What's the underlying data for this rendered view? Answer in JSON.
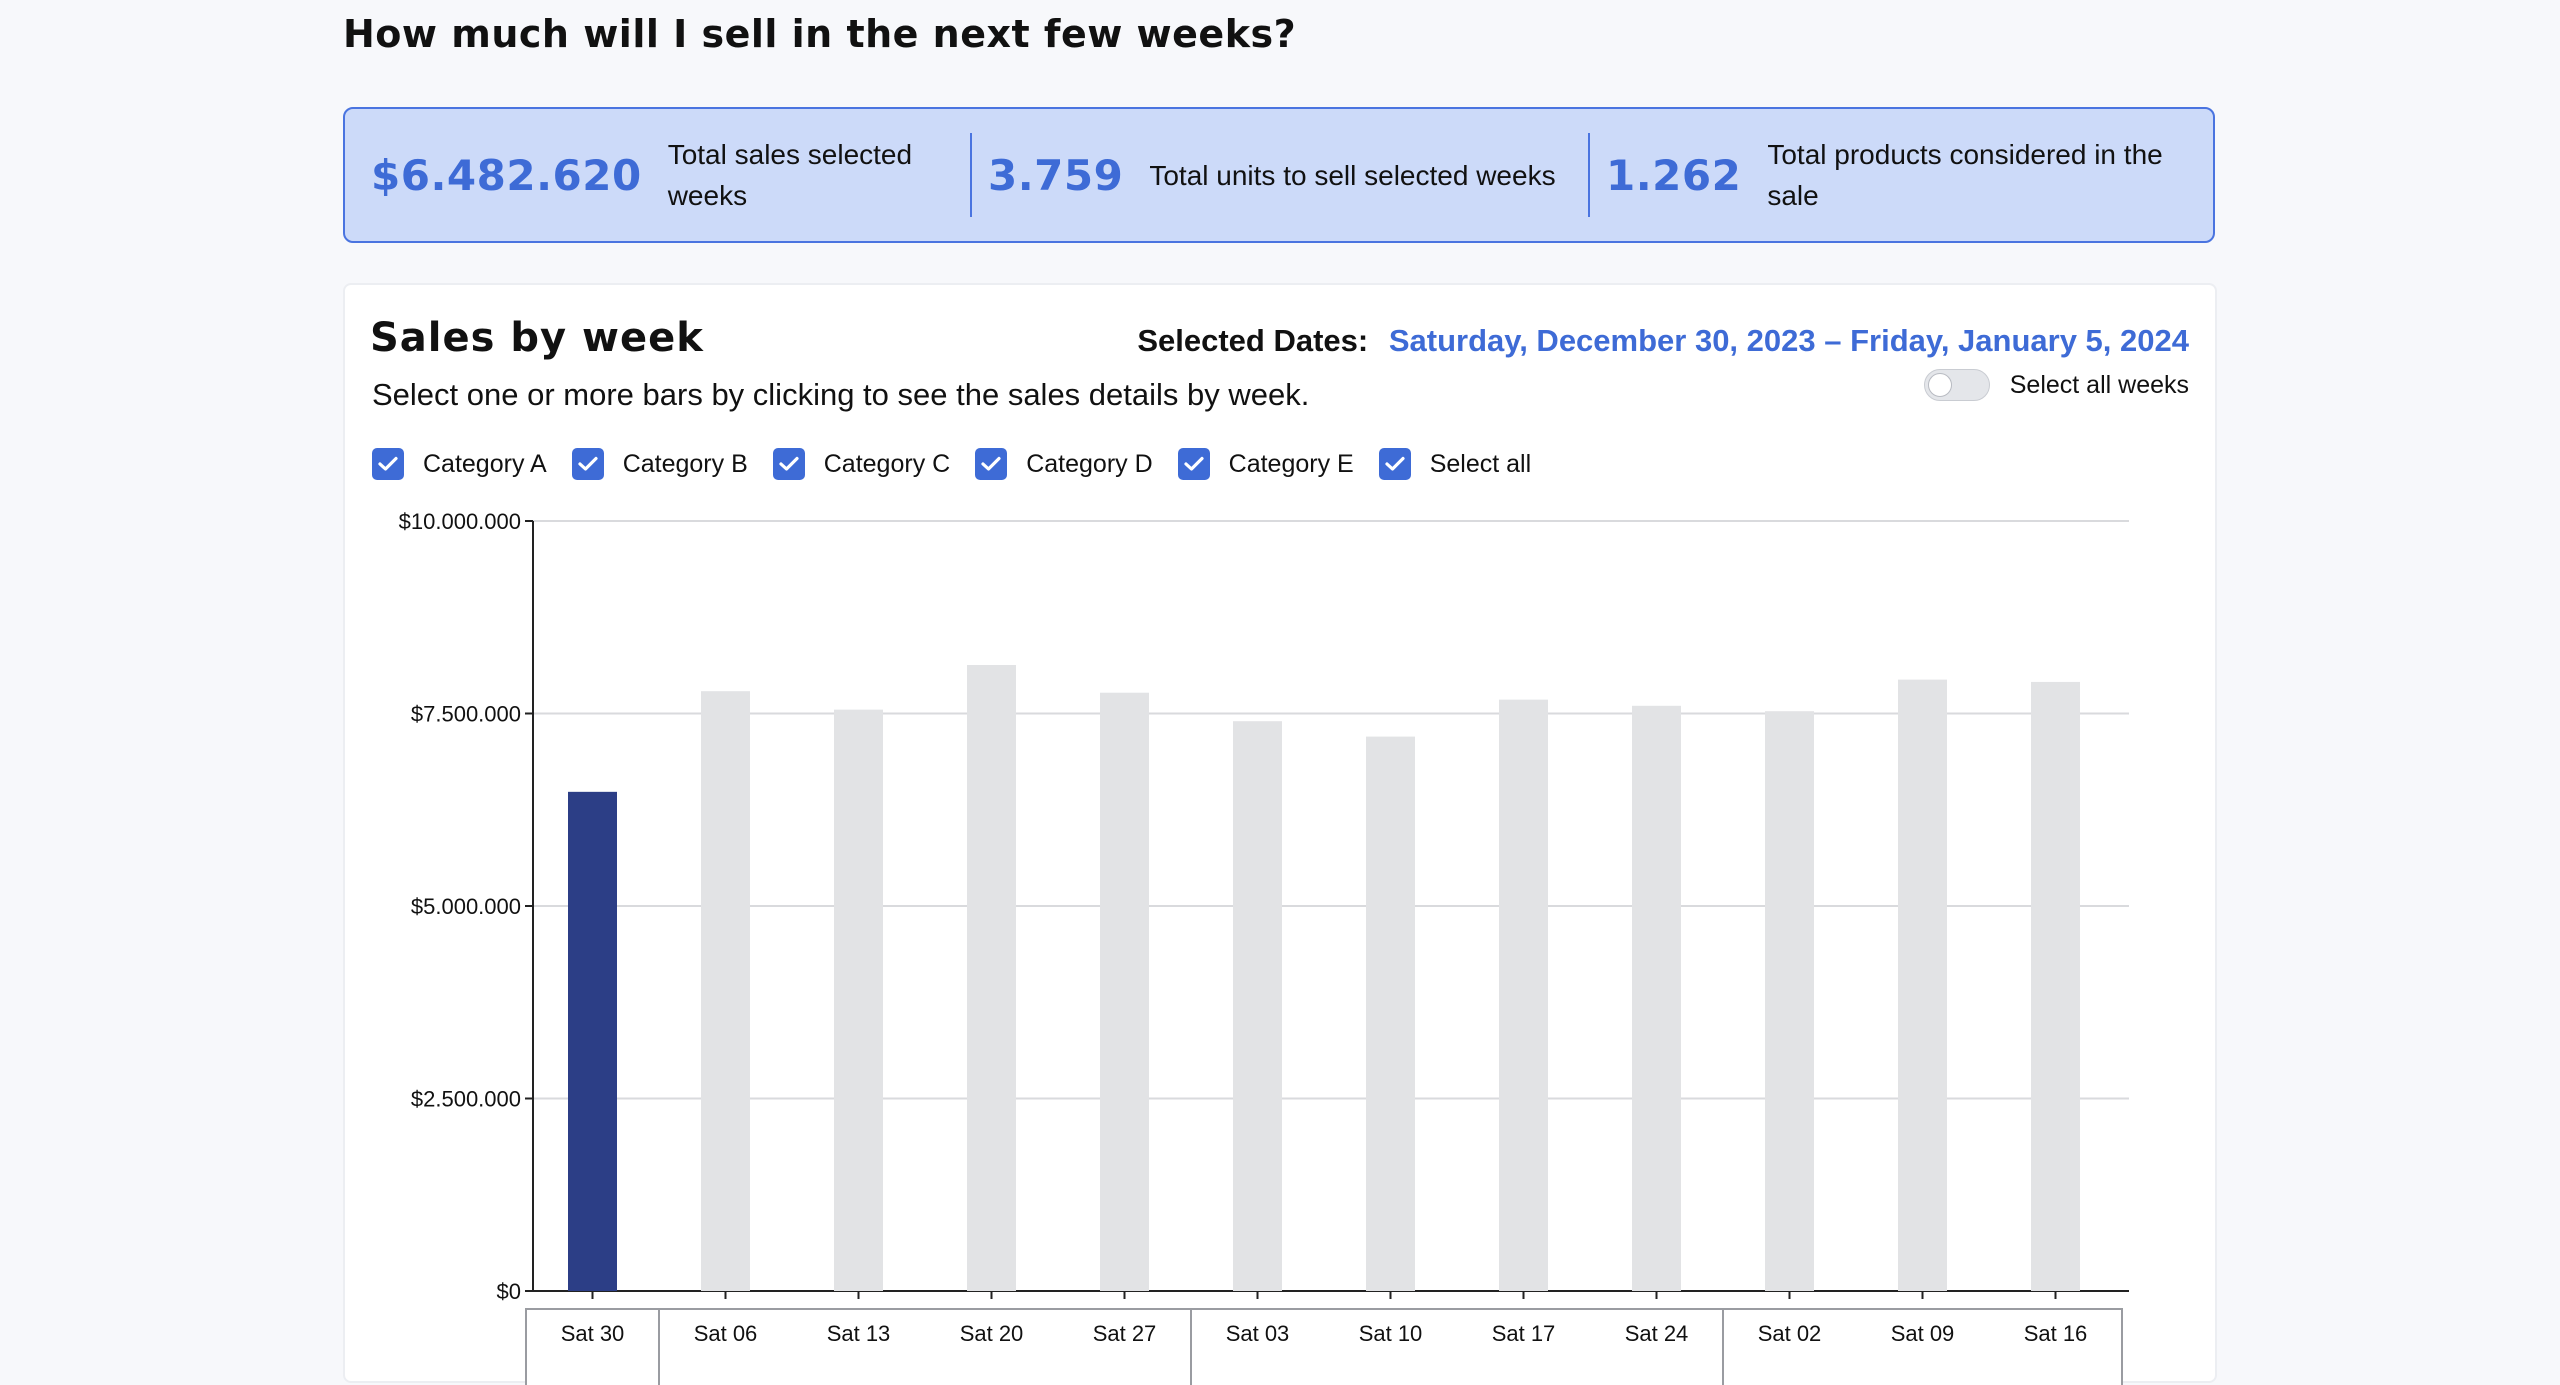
{
  "page": {
    "title": "How much will I sell in the next few weeks?"
  },
  "kpis": [
    {
      "value": "$6.482.620",
      "label": "Total sales selected weeks"
    },
    {
      "value": "3.759",
      "label": "Total units to sell selected weeks"
    },
    {
      "value": "1.262",
      "label": "Total products considered in the sale"
    }
  ],
  "card": {
    "title": "Sales by week",
    "subtitle": "Select one or more bars by clicking to see the sales details by week.",
    "dates_label": "Selected Dates:",
    "dates_value": "Saturday, December 30, 2023 – Friday, January 5, 2024",
    "toggle_label": "Select all weeks",
    "toggle_on": false
  },
  "filters": [
    {
      "label": "Category A",
      "checked": true
    },
    {
      "label": "Category B",
      "checked": true
    },
    {
      "label": "Category C",
      "checked": true
    },
    {
      "label": "Category D",
      "checked": true
    },
    {
      "label": "Category E",
      "checked": true
    },
    {
      "label": "Select all",
      "checked": true
    }
  ],
  "colors": {
    "accent": "#3e6bd6",
    "selected_bar": "#2c3e86",
    "unselected_bar": "#e2e3e5",
    "kpi_background": "#ccdaf9"
  },
  "icons": {
    "checkbox": "check-icon"
  },
  "chart_data": {
    "type": "bar",
    "categories": [
      "Sat 30",
      "Sat 06",
      "Sat 13",
      "Sat 20",
      "Sat 27",
      "Sat 03",
      "Sat 10",
      "Sat 17",
      "Sat 24",
      "Sat 02",
      "Sat 09",
      "Sat 16"
    ],
    "values": [
      6482620,
      7790000,
      7550000,
      8130000,
      7770000,
      7400000,
      7200000,
      7680000,
      7600000,
      7530000,
      7940000,
      7910000
    ],
    "selected": [
      true,
      false,
      false,
      false,
      false,
      false,
      false,
      false,
      false,
      false,
      false,
      false
    ],
    "yticks": [
      "$0",
      "$2.500.000",
      "$5.000.000",
      "$7.500.000",
      "$10.000.000"
    ],
    "ylim": [
      0,
      10000000
    ],
    "grid": true,
    "title": "",
    "xlabel": "",
    "ylabel": ""
  }
}
